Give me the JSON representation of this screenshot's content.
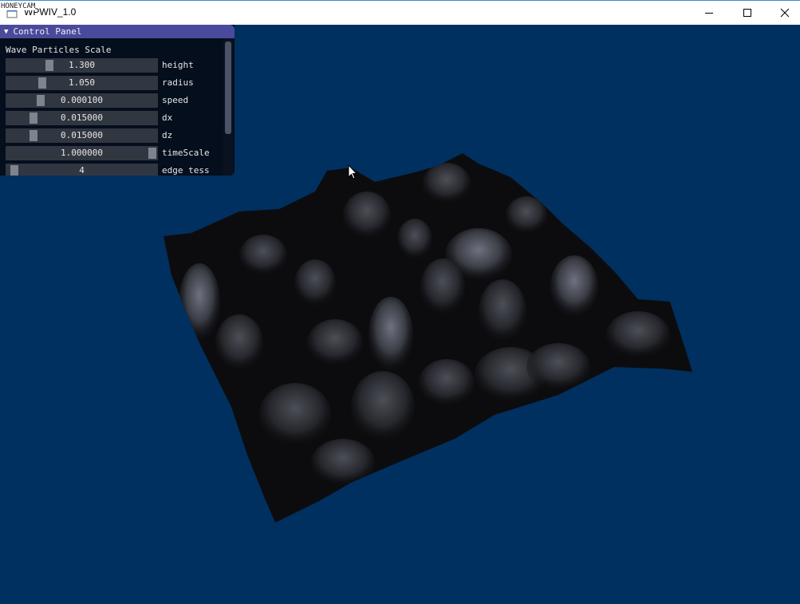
{
  "watermark": "HONEYCAM",
  "window": {
    "title": "WPWIV_1.0",
    "controls": {
      "minimize_icon": "minimize-icon",
      "maximize_icon": "maximize-icon",
      "close_icon": "close-icon"
    }
  },
  "colors": {
    "viewport_bg": "#00305f",
    "panel_header": "#4a4a9c",
    "slider_track": "#313741",
    "slider_grab": "#7e8390"
  },
  "control_panel": {
    "title": "Control Panel",
    "collapse_icon": "triangle-down-icon",
    "section": "Wave Particles Scale",
    "sliders": [
      {
        "label": "height",
        "value": "1.300",
        "fraction": 0.27
      },
      {
        "label": "radius",
        "value": "1.050",
        "fraction": 0.22
      },
      {
        "label": "speed",
        "value": "0.000100",
        "fraction": 0.21
      },
      {
        "label": "dx",
        "value": "0.015000",
        "fraction": 0.16
      },
      {
        "label": "dz",
        "value": "0.015000",
        "fraction": 0.16
      },
      {
        "label": "timeScale",
        "value": "1.000000",
        "fraction": 1.0
      },
      {
        "label": "edge tess",
        "value": "4",
        "fraction": 0.02
      }
    ]
  }
}
